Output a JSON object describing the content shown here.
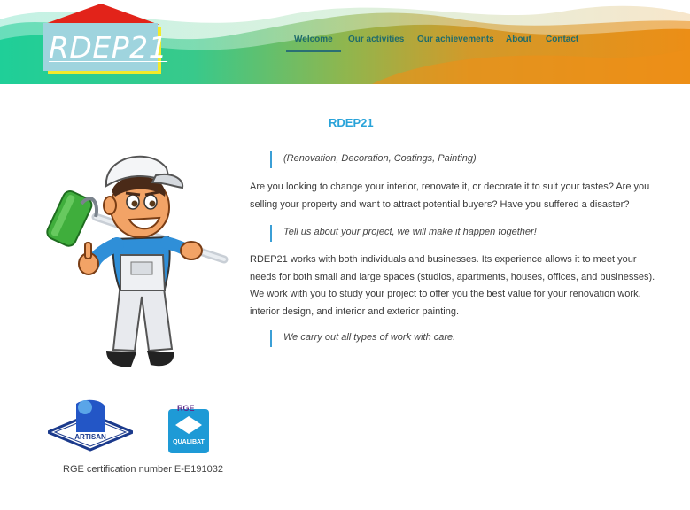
{
  "header": {
    "logo_text": "RDEP21",
    "nav": [
      {
        "label": "Welcome",
        "active": true
      },
      {
        "label": "Our activities",
        "active": false
      },
      {
        "label": "Our achievements",
        "active": false
      },
      {
        "label": "About",
        "active": false
      },
      {
        "label": "Contact",
        "active": false
      }
    ]
  },
  "main": {
    "title": "RDEP21",
    "quote1": "(Renovation, Decoration, Coatings, Painting)",
    "para1": "Are you looking to change your interior, renovate it, or decorate it to suit your tastes? Are you selling your property and want to attract potential buyers? Have you suffered a disaster?",
    "quote2": "Tell us about your project, we will make it happen together!",
    "para2": "RDEP21 works with both individuals and businesses. Its experience allows it to meet your needs for both small and large spaces (studios, apartments, houses, offices, and businesses). We work with you to study your project to offer you the best value for your renovation work, interior design, and interior and exterior painting.",
    "quote3": "We carry out all types of work with care."
  },
  "badges": {
    "artisan_label": "ARTISAN",
    "rge_label": "RGE",
    "qualibat_label": "QUALIBAT",
    "certification_text": "RGE certification number E-E191032"
  },
  "colors": {
    "accent_blue": "#29a3d9",
    "nav_text": "#1e6b6b",
    "roof_red": "#e2231a",
    "logo_box": "#9fd3dc",
    "wave_green": "#2ecc9a",
    "wave_orange": "#ea8f1c"
  }
}
